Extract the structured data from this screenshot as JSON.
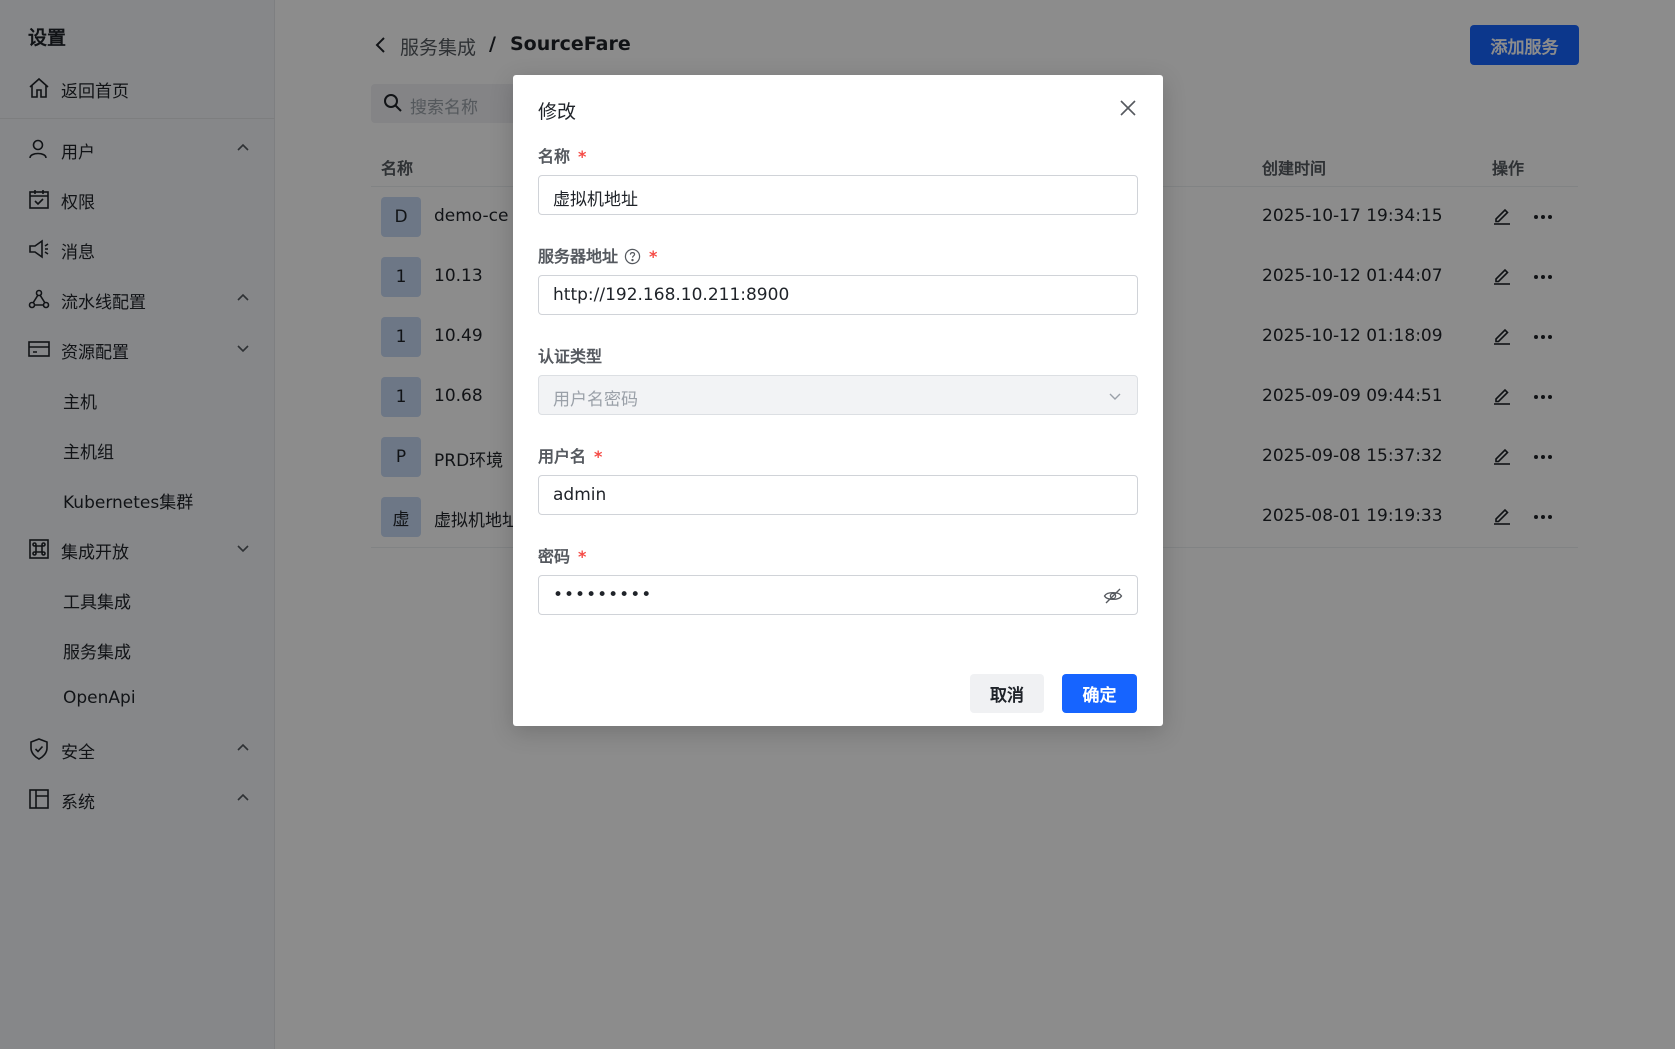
{
  "sidebar": {
    "title": "设置",
    "home": "返回首页",
    "items": [
      {
        "label": "用户"
      },
      {
        "label": "权限"
      },
      {
        "label": "消息"
      },
      {
        "label": "流水线配置"
      },
      {
        "label": "资源配置"
      },
      {
        "label": "主机"
      },
      {
        "label": "主机组"
      },
      {
        "label": "Kubernetes集群"
      },
      {
        "label": "集成开放"
      },
      {
        "label": "工具集成"
      },
      {
        "label": "服务集成"
      },
      {
        "label": "OpenApi"
      },
      {
        "label": "安全"
      },
      {
        "label": "系统"
      }
    ]
  },
  "header": {
    "breadcrumb_parent": "服务集成",
    "breadcrumb_sep": "/",
    "breadcrumb_current": "SourceFare",
    "add_button": "添加服务"
  },
  "search": {
    "placeholder": "搜索名称"
  },
  "table": {
    "columns": {
      "name": "名称",
      "created": "创建时间",
      "actions": "操作"
    },
    "rows": [
      {
        "avatar": "D",
        "name": "demo-ce",
        "created": "2025-10-17 19:34:15"
      },
      {
        "avatar": "1",
        "name": "10.13",
        "created": "2025-10-12 01:44:07"
      },
      {
        "avatar": "1",
        "name": "10.49",
        "created": "2025-10-12 01:18:09"
      },
      {
        "avatar": "1",
        "name": "10.68",
        "created": "2025-09-09 09:44:51"
      },
      {
        "avatar": "P",
        "name": "PRD环境",
        "created": "2025-09-08 15:37:32"
      },
      {
        "avatar": "虚",
        "name": "虚拟机地址",
        "created": "2025-08-01 19:19:33"
      }
    ]
  },
  "modal": {
    "title": "修改",
    "required_mark": "*",
    "fields": {
      "name": {
        "label": "名称",
        "value": "虚拟机地址"
      },
      "server": {
        "label": "服务器地址",
        "value": "http://192.168.10.211:8900"
      },
      "auth": {
        "label": "认证类型",
        "value": "用户名密码"
      },
      "username": {
        "label": "用户名",
        "value": "admin"
      },
      "password": {
        "label": "密码",
        "value": "•••••••••"
      }
    },
    "cancel": "取消",
    "confirm": "确定"
  },
  "colors": {
    "accent": "#1664ff",
    "required": "#f54a45",
    "avatar_bg": "#c6d9f5"
  }
}
